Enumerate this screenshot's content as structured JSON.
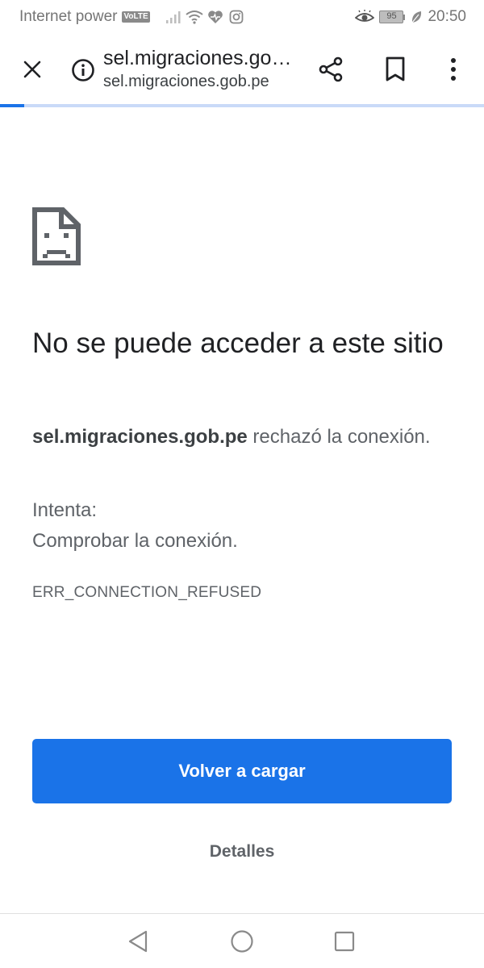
{
  "status_bar": {
    "carrier": "Internet power",
    "network_badge": "VoLTE",
    "battery_level": "95",
    "time": "20:50",
    "icons": [
      "signal-icon",
      "wifi-icon",
      "health-icon",
      "instagram-icon",
      "eye-comfort-icon",
      "battery-icon",
      "leaf-icon"
    ]
  },
  "toolbar": {
    "page_title": "sel.migraciones.gob.pe",
    "page_url": "sel.migraciones.gob.pe",
    "icons": [
      "close-icon",
      "info-icon",
      "share-icon",
      "bookmark-icon",
      "more-vert-icon"
    ],
    "load_progress": 0.05
  },
  "error": {
    "icon": "sad-document-icon",
    "title": "No se puede acceder a este sitio",
    "host": "sel.migraciones.gob.pe",
    "message": " rechazó la conexión.",
    "try_label": "Intenta:",
    "suggestion": "Comprobar la conexión.",
    "code": "ERR_CONNECTION_REFUSED",
    "reload_label": "Volver a cargar",
    "details_label": "Detalles"
  },
  "colors": {
    "accent": "#1a73e8",
    "progress_track": "#c9daf8",
    "text_primary": "#202124",
    "text_secondary": "#5f6368"
  },
  "nav_bar": {
    "icons": [
      "back-icon",
      "home-icon",
      "recents-icon"
    ]
  }
}
